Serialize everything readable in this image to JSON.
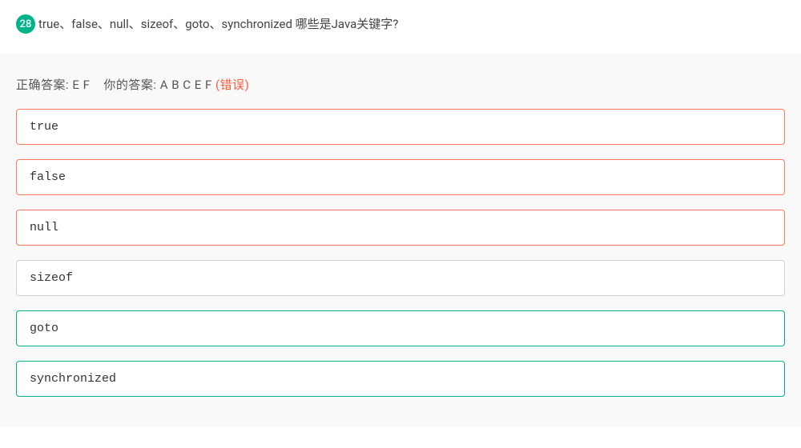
{
  "question": {
    "number": "28",
    "text": "true、false、null、sizeof、goto、synchronized 哪些是Java关键字?"
  },
  "summary": {
    "correct_label": "正确答案:",
    "correct_value": "E F",
    "your_label": "你的答案:",
    "your_value": "A B C E F",
    "error_text": "(错误)"
  },
  "options": [
    {
      "label": "true",
      "state": "wrong"
    },
    {
      "label": "false",
      "state": "wrong"
    },
    {
      "label": "null",
      "state": "wrong"
    },
    {
      "label": "sizeof",
      "state": "neutral"
    },
    {
      "label": "goto",
      "state": "correct"
    },
    {
      "label": "synchronized",
      "state": "correct"
    }
  ]
}
